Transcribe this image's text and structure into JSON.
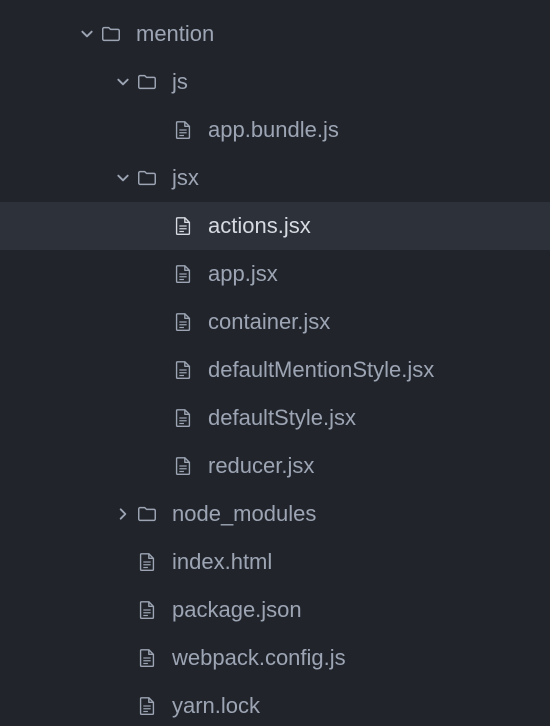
{
  "tree": {
    "base_indent": 76,
    "indent_step": 36,
    "chevron_width": 22,
    "items": [
      {
        "depth": 0,
        "type": "folder",
        "open": true,
        "label": "mention",
        "selected": false
      },
      {
        "depth": 1,
        "type": "folder",
        "open": true,
        "label": "js",
        "selected": false
      },
      {
        "depth": 2,
        "type": "file",
        "label": "app.bundle.js",
        "selected": false
      },
      {
        "depth": 1,
        "type": "folder",
        "open": true,
        "label": "jsx",
        "selected": false
      },
      {
        "depth": 2,
        "type": "file",
        "label": "actions.jsx",
        "selected": true
      },
      {
        "depth": 2,
        "type": "file",
        "label": "app.jsx",
        "selected": false
      },
      {
        "depth": 2,
        "type": "file",
        "label": "container.jsx",
        "selected": false
      },
      {
        "depth": 2,
        "type": "file",
        "label": "defaultMentionStyle.jsx",
        "selected": false
      },
      {
        "depth": 2,
        "type": "file",
        "label": "defaultStyle.jsx",
        "selected": false
      },
      {
        "depth": 2,
        "type": "file",
        "label": "reducer.jsx",
        "selected": false
      },
      {
        "depth": 1,
        "type": "folder",
        "open": false,
        "label": "node_modules",
        "selected": false
      },
      {
        "depth": 1,
        "type": "file",
        "label": "index.html",
        "selected": false
      },
      {
        "depth": 1,
        "type": "file",
        "label": "package.json",
        "selected": false
      },
      {
        "depth": 1,
        "type": "file",
        "label": "webpack.config.js",
        "selected": false
      },
      {
        "depth": 1,
        "type": "file",
        "label": "yarn.lock",
        "selected": false
      }
    ]
  },
  "colors": {
    "bg": "#21252b",
    "fg": "#9da5b4",
    "selected_bg": "#2c313a",
    "selected_fg": "#d7dae0"
  }
}
